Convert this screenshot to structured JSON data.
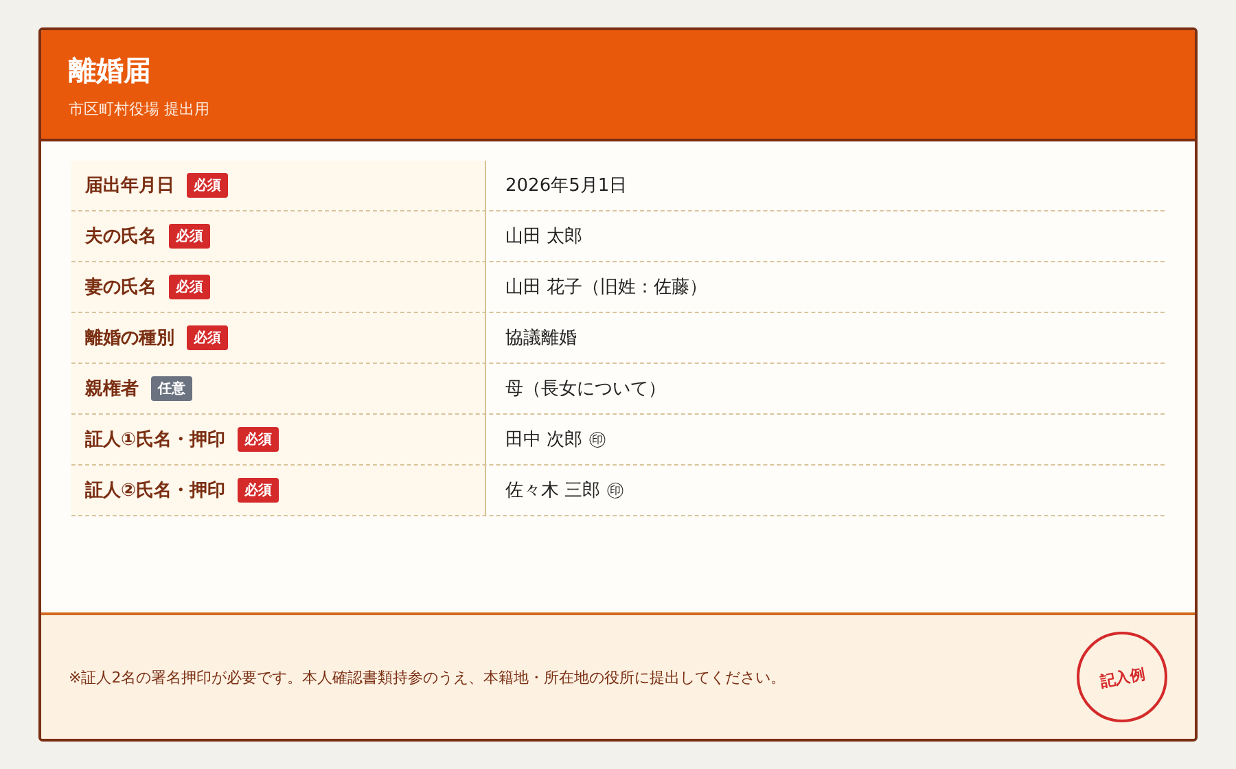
{
  "header": {
    "title": "離婚届",
    "subtitle": "市区町村役場 提出用"
  },
  "rows": [
    {
      "label": "届出年月日",
      "badge": {
        "kind": "required",
        "text": "必須"
      },
      "value": "2026年5月1日"
    },
    {
      "label": "夫の氏名",
      "badge": {
        "kind": "required",
        "text": "必須"
      },
      "value": "山田 太郎"
    },
    {
      "label": "妻の氏名",
      "badge": {
        "kind": "required",
        "text": "必須"
      },
      "value": "山田 花子（旧姓：佐藤）"
    },
    {
      "label": "離婚の種別",
      "badge": {
        "kind": "required",
        "text": "必須"
      },
      "value": "協議離婚"
    },
    {
      "label": "親権者",
      "badge": {
        "kind": "optional",
        "text": "任意"
      },
      "value": "母（長女について）"
    },
    {
      "label": "証人①氏名・押印",
      "badge": {
        "kind": "required",
        "text": "必須"
      },
      "value": "田中 次郎 ㊞"
    },
    {
      "label": "証人②氏名・押印",
      "badge": {
        "kind": "required",
        "text": "必須"
      },
      "value": "佐々木 三郎 ㊞"
    }
  ],
  "footer": {
    "note": "※証人2名の署名押印が必要です。本人確認書類持参のうえ、本籍地・所在地の役所に提出してください。",
    "stamp": "記入例"
  }
}
